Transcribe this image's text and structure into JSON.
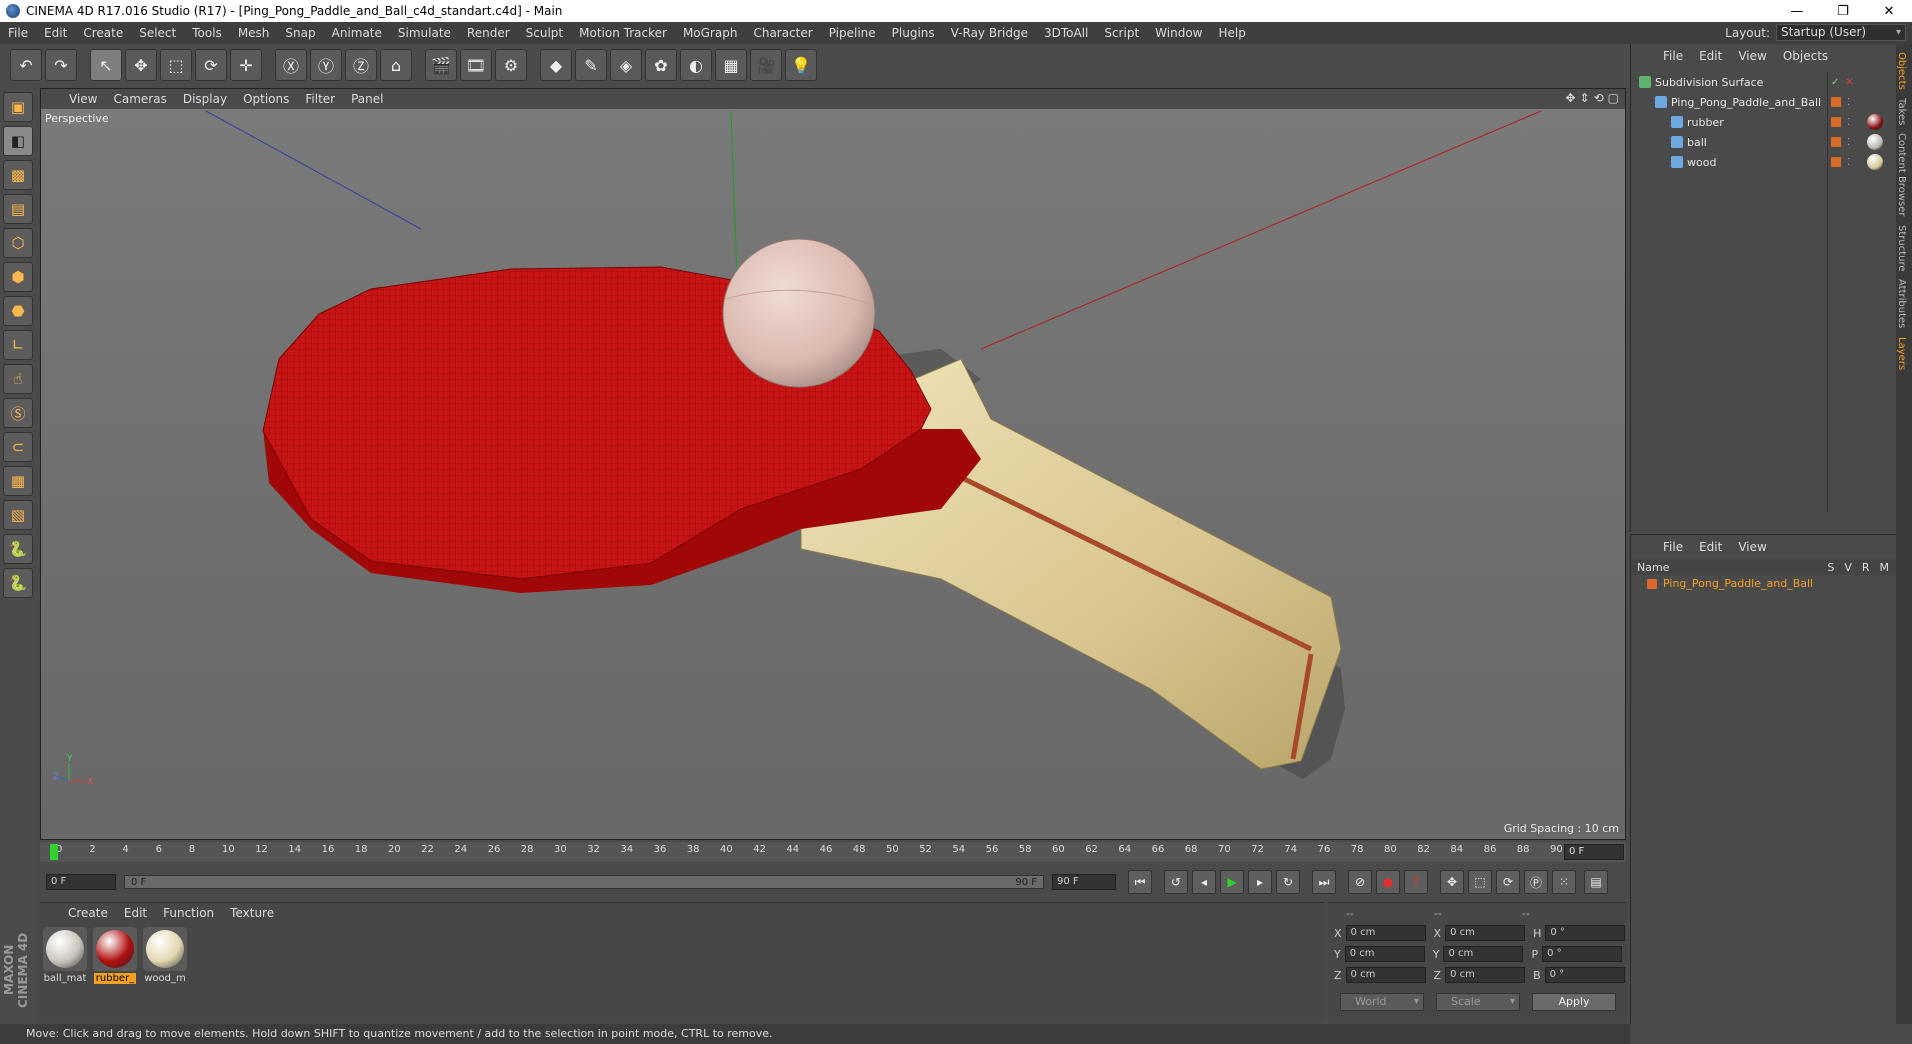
{
  "window": {
    "title": "CINEMA 4D R17.016 Studio (R17) - [Ping_Pong_Paddle_and_Ball_c4d_standart.c4d] - Main",
    "minimize": "—",
    "restore": "❐",
    "close": "✕"
  },
  "menubar": [
    "File",
    "Edit",
    "Create",
    "Select",
    "Tools",
    "Mesh",
    "Snap",
    "Animate",
    "Simulate",
    "Render",
    "Sculpt",
    "Motion Tracker",
    "MoGraph",
    "Character",
    "Pipeline",
    "Plugins",
    "V-Ray Bridge",
    "3DToAll",
    "Script",
    "Window",
    "Help"
  ],
  "layout": {
    "label": "Layout:",
    "value": "Startup (User)"
  },
  "viewport": {
    "menu": [
      "View",
      "Cameras",
      "Display",
      "Options",
      "Filter",
      "Panel"
    ],
    "label": "Perspective",
    "grid_spacing": "Grid Spacing : 10 cm",
    "axis_labels": {
      "x": "X",
      "y": "Y",
      "z": "Z"
    }
  },
  "timeline": {
    "ticks": [
      "0",
      "2",
      "4",
      "6",
      "8",
      "10",
      "12",
      "14",
      "16",
      "18",
      "20",
      "22",
      "24",
      "26",
      "28",
      "30",
      "32",
      "34",
      "36",
      "38",
      "40",
      "42",
      "44",
      "46",
      "48",
      "50",
      "52",
      "54",
      "56",
      "58",
      "60",
      "62",
      "64",
      "66",
      "68",
      "70",
      "72",
      "74",
      "76",
      "78",
      "80",
      "82",
      "84",
      "86",
      "88",
      "90"
    ],
    "current_frame": "0 F"
  },
  "transport": {
    "start": "0 F",
    "range_start": "0 F",
    "range_end": "90 F",
    "end": "90 F"
  },
  "materials": {
    "menu": [
      "Create",
      "Edit",
      "Function",
      "Texture"
    ],
    "items": [
      {
        "label": "ball_mat",
        "color": "#c9c6bd",
        "selected": false
      },
      {
        "label": "rubber_",
        "color": "#b01010",
        "selected": true
      },
      {
        "label": "wood_m",
        "color": "#e3d7b0",
        "selected": false
      }
    ]
  },
  "coordinates": {
    "headers": [
      "--",
      "--",
      "--"
    ],
    "rows": [
      {
        "a": "X",
        "av": "0 cm",
        "b": "X",
        "bv": "0 cm",
        "c": "H",
        "cv": "0 °"
      },
      {
        "a": "Y",
        "av": "0 cm",
        "b": "Y",
        "bv": "0 cm",
        "c": "P",
        "cv": "0 °"
      },
      {
        "a": "Z",
        "av": "0 cm",
        "b": "Z",
        "bv": "0 cm",
        "c": "B",
        "cv": "0 °"
      }
    ],
    "world": "World",
    "scale": "Scale",
    "apply": "Apply"
  },
  "status": "Move: Click and drag to move elements. Hold down SHIFT to quantize movement / add to the selection in point mode, CTRL to remove.",
  "objects": {
    "menu": [
      "File",
      "Edit",
      "View",
      "Objects"
    ],
    "rows": [
      {
        "name": "Subdivision Surface",
        "indent": 0
      },
      {
        "name": "Ping_Pong_Paddle_and_Ball",
        "indent": 1
      },
      {
        "name": "rubber",
        "indent": 2,
        "tag": "#8a1010"
      },
      {
        "name": "ball",
        "indent": 2,
        "tag": "#bdbab2"
      },
      {
        "name": "wood",
        "indent": 2,
        "tag": "#d8c99a"
      }
    ]
  },
  "layers": {
    "menu": [
      "File",
      "Edit",
      "View"
    ],
    "head": {
      "name": "Name",
      "cols": [
        "S",
        "V",
        "R",
        "M"
      ]
    },
    "row": "Ping_Pong_Paddle_and_Ball"
  },
  "sidetabs": [
    "Objects",
    "Takes",
    "Content Browser",
    "Structure",
    "Attributes",
    "Layers"
  ],
  "brand": "MAXON CINEMA 4D"
}
